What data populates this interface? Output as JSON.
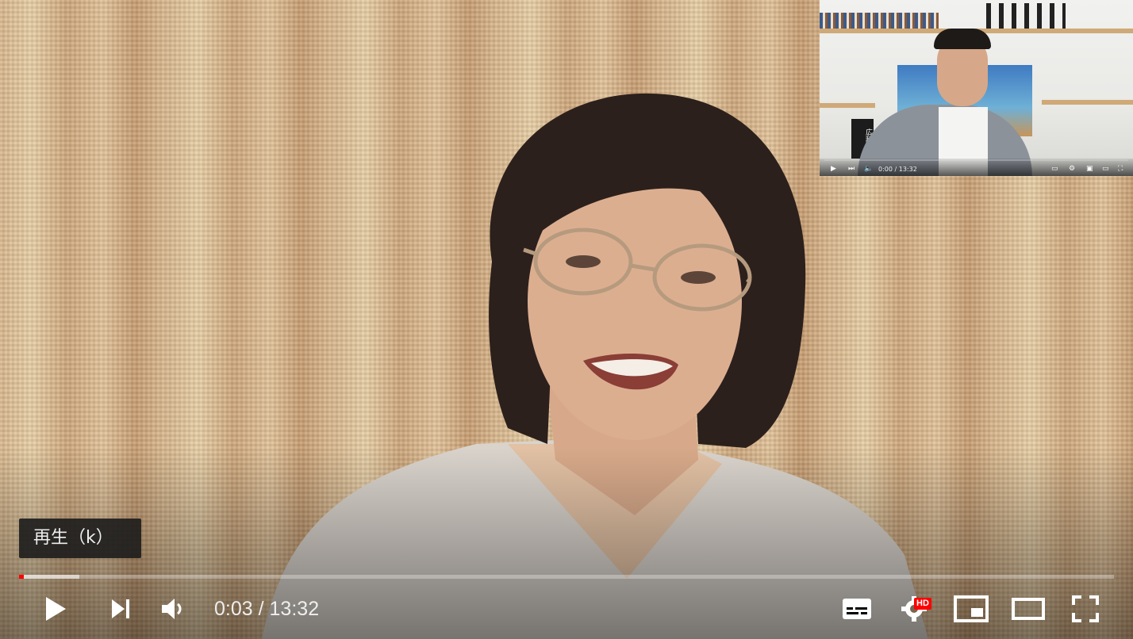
{
  "player": {
    "tooltip": "再生（k）",
    "time_current": "0:03",
    "time_separator": "/",
    "time_total": "13:32",
    "progress_played": 0.004,
    "progress_loaded": 0.055,
    "hd_badge": "HD",
    "accent_color": "#ff0000"
  },
  "controls": {
    "play_icon": "play-icon",
    "next_icon": "next-icon",
    "volume_icon": "volume-icon",
    "subtitles_icon": "subtitles-icon",
    "settings_icon": "gear-icon",
    "miniplayer_icon": "miniplayer-icon",
    "theater_icon": "theater-mode-icon",
    "fullscreen_icon": "fullscreen-icon"
  },
  "pip": {
    "time": "0:00 / 13:32",
    "book_label": "広辞苑"
  }
}
